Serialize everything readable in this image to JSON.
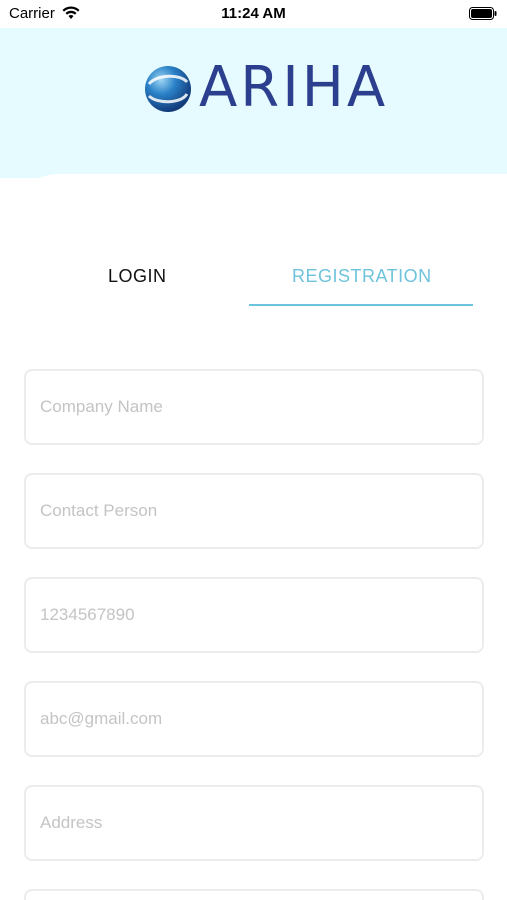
{
  "status": {
    "carrier": "Carrier",
    "time": "11:24 AM"
  },
  "brand": {
    "logo_text": "ARIHA"
  },
  "tabs": {
    "login": "LOGIN",
    "registration": "REGISTRATION"
  },
  "form": {
    "company_name": {
      "placeholder": "Company Name",
      "value": ""
    },
    "contact_person": {
      "placeholder": "Contact Person",
      "value": ""
    },
    "phone": {
      "placeholder": "1234567890",
      "value": ""
    },
    "email": {
      "placeholder": "abc@gmail.com",
      "value": ""
    },
    "address": {
      "placeholder": "Address",
      "value": ""
    }
  },
  "colors": {
    "accent": "#6ec3dc",
    "header_bg": "#e6fbff",
    "logo": "#2c3f8f"
  }
}
